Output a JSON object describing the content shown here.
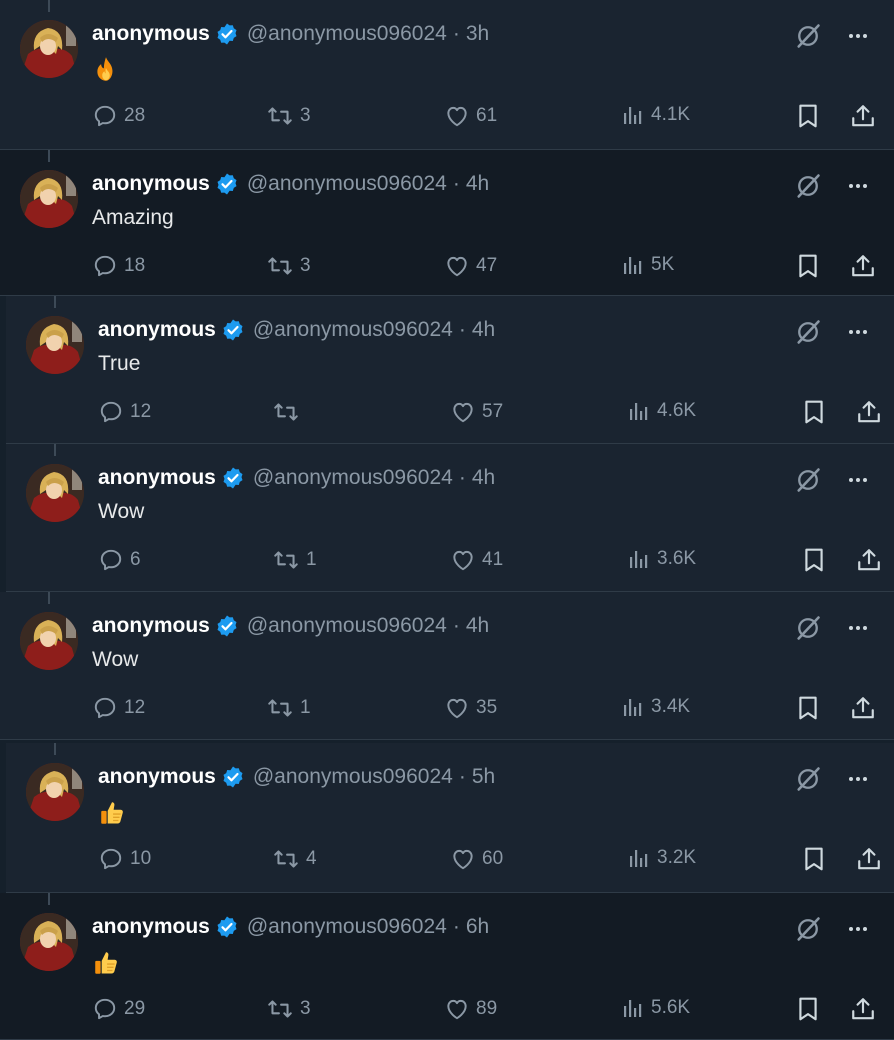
{
  "colors": {
    "bg": "#15202b",
    "text": "#e7e9ea",
    "muted": "#8b98a5",
    "verified": "#1d9bf0"
  },
  "tweets": [
    {
      "name": "anonymous",
      "handle": "@anonymous096024",
      "sep": "·",
      "time": "3h",
      "content": "",
      "emoji": "fire",
      "replies": "28",
      "retweets": "3",
      "likes": "61",
      "views": "4.1K"
    },
    {
      "name": "anonymous",
      "handle": "@anonymous096024",
      "sep": "·",
      "time": "4h",
      "content": "Amazing",
      "emoji": "",
      "replies": "18",
      "retweets": "3",
      "likes": "47",
      "views": "5K"
    },
    {
      "name": "anonymous",
      "handle": "@anonymous096024",
      "sep": "·",
      "time": "4h",
      "content": "True",
      "emoji": "",
      "replies": "12",
      "retweets": "",
      "likes": "57",
      "views": "4.6K"
    },
    {
      "name": "anonymous",
      "handle": "@anonymous096024",
      "sep": "·",
      "time": "4h",
      "content": "Wow",
      "emoji": "",
      "replies": "6",
      "retweets": "1",
      "likes": "41",
      "views": "3.6K"
    },
    {
      "name": "anonymous",
      "handle": "@anonymous096024",
      "sep": "·",
      "time": "4h",
      "content": "Wow",
      "emoji": "",
      "replies": "12",
      "retweets": "1",
      "likes": "35",
      "views": "3.4K"
    },
    {
      "name": "anonymous",
      "handle": "@anonymous096024",
      "sep": "·",
      "time": "5h",
      "content": "",
      "emoji": "thumbs-up",
      "replies": "10",
      "retweets": "4",
      "likes": "60",
      "views": "3.2K"
    },
    {
      "name": "anonymous",
      "handle": "@anonymous096024",
      "sep": "·",
      "time": "6h",
      "content": "",
      "emoji": "thumbs-up",
      "replies": "29",
      "retweets": "3",
      "likes": "89",
      "views": "5.6K"
    }
  ]
}
